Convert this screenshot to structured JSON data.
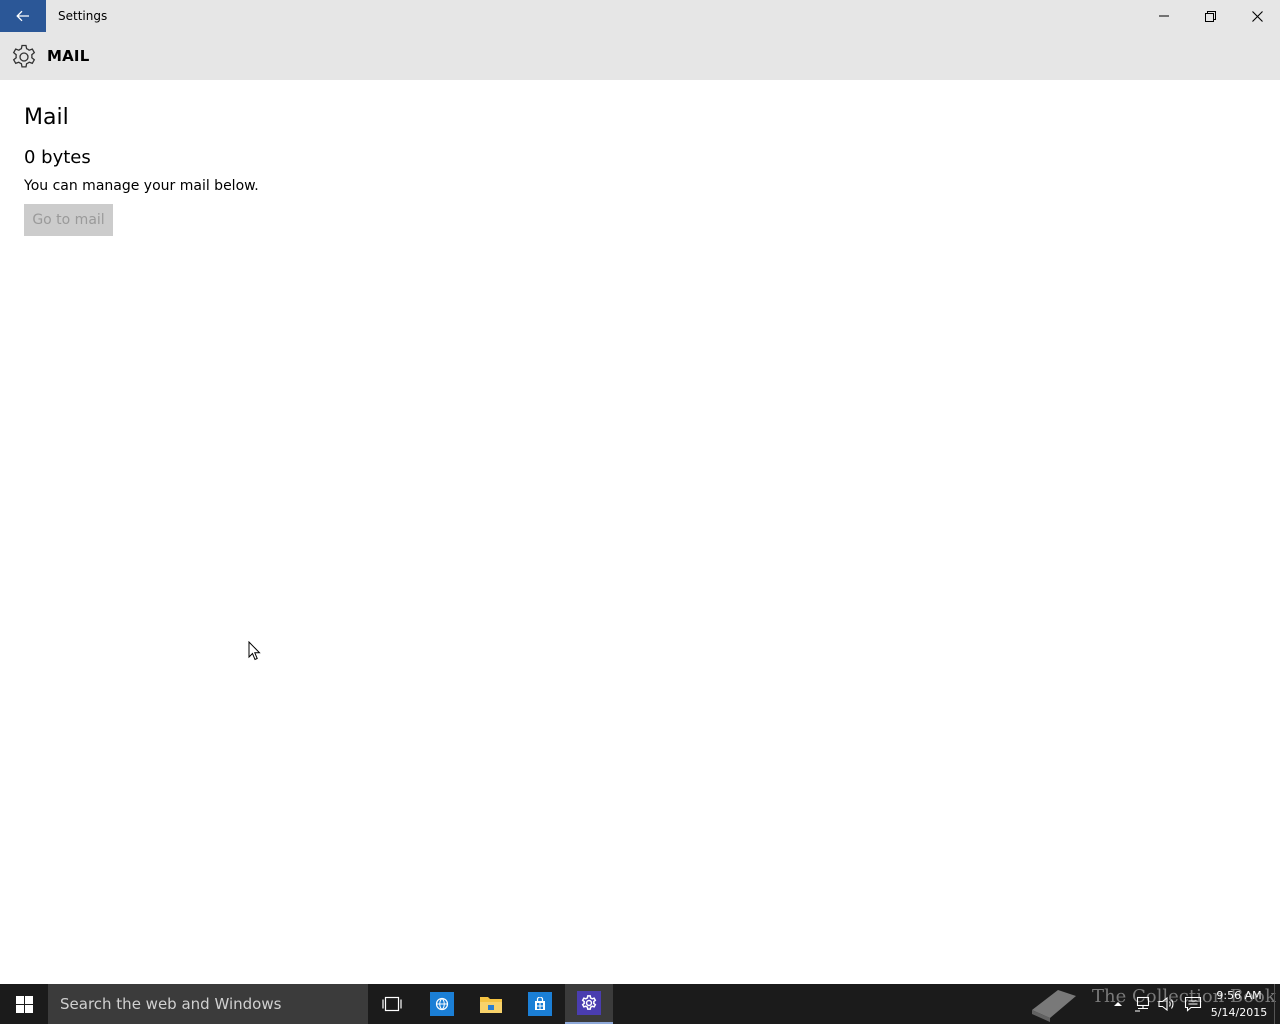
{
  "window": {
    "title": "Settings"
  },
  "header": {
    "title": "MAIL"
  },
  "main": {
    "section_title": "Mail",
    "size_value": "0 bytes",
    "description": "You can manage your mail below.",
    "go_button_label": "Go to mail",
    "go_button_enabled": false
  },
  "taskbar": {
    "search_placeholder": "Search the web and Windows",
    "apps": [
      "task-view-icon",
      "internet-explorer-icon",
      "file-explorer-icon",
      "store-icon",
      "settings-icon"
    ],
    "active_app": "settings-icon"
  },
  "watermark": {
    "text": "The Collection Book"
  },
  "tray": {
    "time": "9:56 AM",
    "date": "5/14/2015"
  },
  "colors": {
    "titlebar_bg": "#e6e6e6",
    "back_button_bg": "#2b5797",
    "taskbar_bg": "#1b1b1b",
    "disabled_button_bg": "#cccccc",
    "disabled_button_text": "#9a9a9a"
  }
}
